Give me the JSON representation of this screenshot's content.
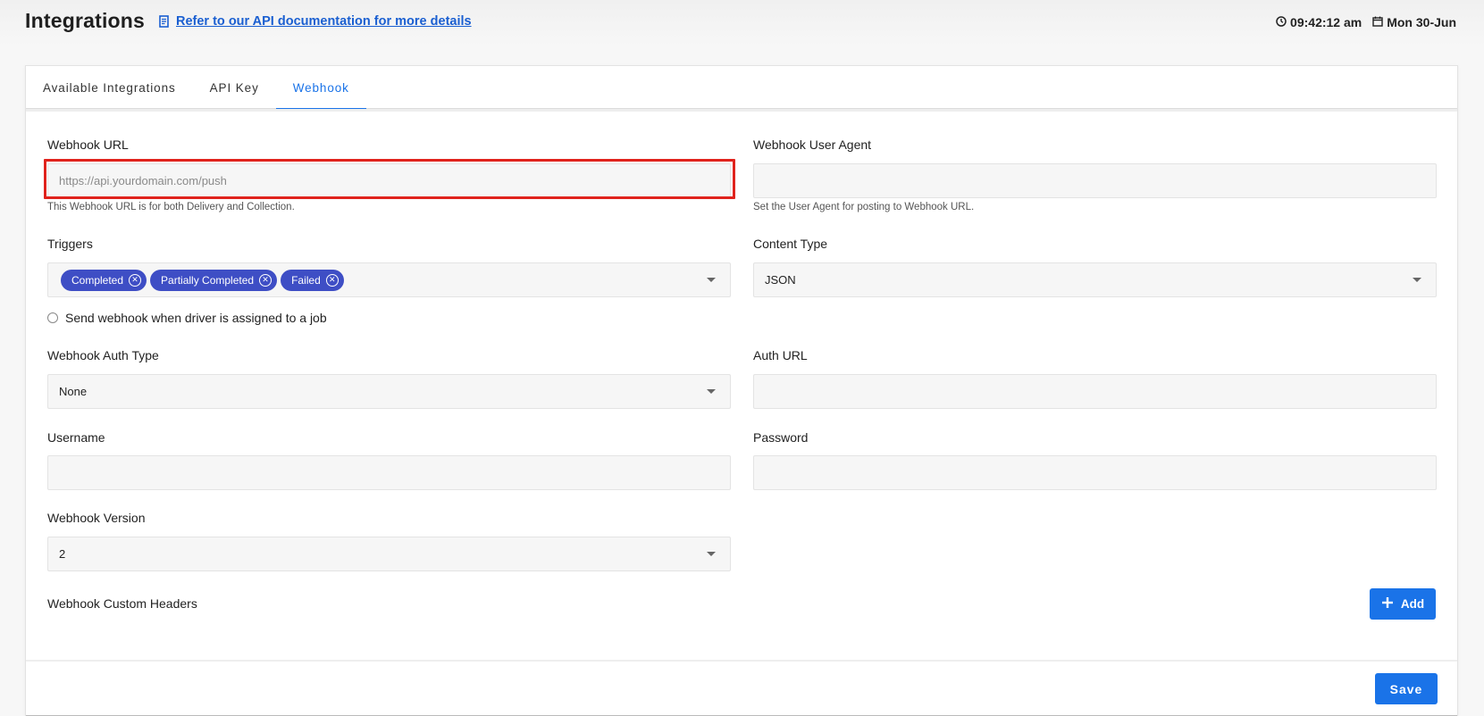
{
  "header": {
    "title": "Integrations",
    "doc_link": "Refer to our API documentation for more details",
    "time": "09:42:12 am",
    "date": "Mon 30-Jun"
  },
  "tabs": [
    {
      "label": "Available Integrations",
      "active": false
    },
    {
      "label": "API Key",
      "active": false
    },
    {
      "label": "Webhook",
      "active": true
    }
  ],
  "form": {
    "webhook_url": {
      "label": "Webhook URL",
      "placeholder": "https://api.yourdomain.com/push",
      "value": "",
      "hint": "This Webhook URL is for both Delivery and Collection."
    },
    "user_agent": {
      "label": "Webhook User Agent",
      "value": "",
      "hint": "Set the User Agent for posting to Webhook URL."
    },
    "triggers": {
      "label": "Triggers",
      "chips": [
        "Completed",
        "Partially Completed",
        "Failed"
      ]
    },
    "content_type": {
      "label": "Content Type",
      "value": "JSON"
    },
    "driver_assigned": {
      "label": "Send webhook when driver is assigned to a job",
      "checked": false
    },
    "auth_type": {
      "label": "Webhook Auth Type",
      "value": "None"
    },
    "auth_url": {
      "label": "Auth URL",
      "value": ""
    },
    "username": {
      "label": "Username",
      "value": ""
    },
    "password": {
      "label": "Password",
      "value": ""
    },
    "version": {
      "label": "Webhook Version",
      "value": "2"
    },
    "custom_headers": {
      "label": "Webhook Custom Headers",
      "add_label": "Add"
    }
  },
  "actions": {
    "save_label": "Save"
  },
  "colors": {
    "accent": "#1a73e8",
    "chip": "#3e4ec5",
    "highlight": "#e0231d"
  }
}
